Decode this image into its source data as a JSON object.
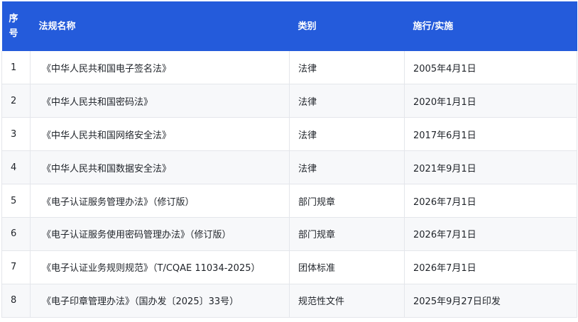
{
  "table": {
    "headers": {
      "seq": "序号",
      "name": "法规名称",
      "category": "类别",
      "effective": "施行/实施"
    },
    "rows": [
      {
        "seq": "1",
        "name": "《中华人民共和国电子签名法》",
        "category": "法律",
        "effective": "2005年4月1日"
      },
      {
        "seq": "2",
        "name": "《中华人民共和国密码法》",
        "category": "法律",
        "effective": "2020年1月1日"
      },
      {
        "seq": "3",
        "name": "《中华人民共和国网络安全法》",
        "category": "法律",
        "effective": "2017年6月1日"
      },
      {
        "seq": "4",
        "name": "《中华人民共和国数据安全法》",
        "category": "法律",
        "effective": "2021年9月1日"
      },
      {
        "seq": "5",
        "name": "《电子认证服务管理办法》（修订版）",
        "category": "部门规章",
        "effective": "2026年7月1日"
      },
      {
        "seq": "6",
        "name": "《电子认证服务使用密码管理办法》（修订版）",
        "category": "部门规章",
        "effective": "2026年7月1日"
      },
      {
        "seq": "7",
        "name": "《电子认证业务规则规范》（T/CQAE 11034-2025）",
        "category": "团体标准",
        "effective": "2026年7月1日"
      },
      {
        "seq": "8",
        "name": "《电子印章管理办法》（国办发〔2025〕33号）",
        "category": "规范性文件",
        "effective": "2025年9月27日印发"
      }
    ]
  },
  "colors": {
    "header_bg": "#245bdb",
    "header_text": "#ffffff",
    "row_alt_bg": "#f7f8fa",
    "border": "#e4e6eb",
    "body_text": "#1f2329"
  }
}
